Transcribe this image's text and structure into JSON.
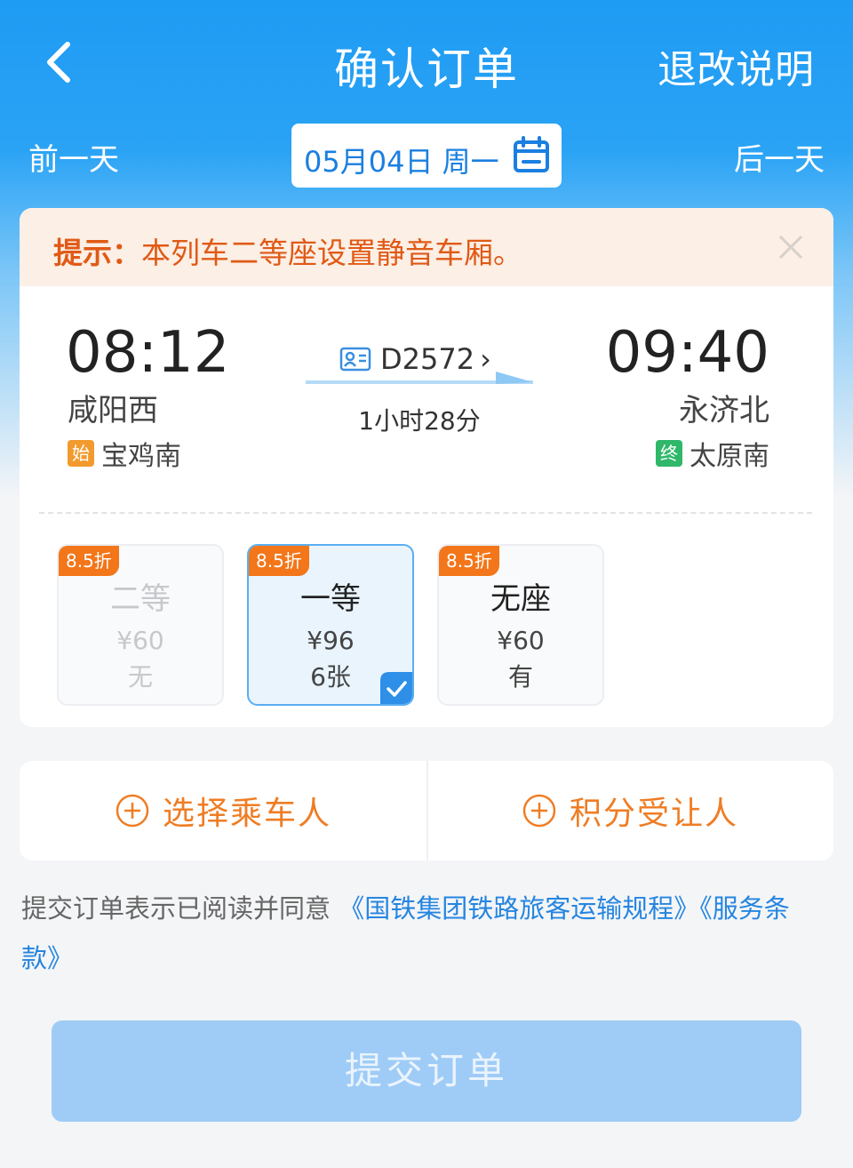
{
  "header": {
    "title": "确认订单",
    "rule_link": "退改说明"
  },
  "date_bar": {
    "prev_label": "前一天",
    "next_label": "后一天",
    "date": "05月04日 周一"
  },
  "tip": {
    "label": "提示：",
    "text": "本列车二等座设置静音车厢。"
  },
  "trip": {
    "departure_time": "08:12",
    "departure_station": "咸阳西",
    "origin_badge": "始",
    "origin_station": "宝鸡南",
    "train_number": "D2572",
    "train_chevron": "›",
    "duration": "1小时28分",
    "arrival_time": "09:40",
    "arrival_station": "永济北",
    "terminal_badge": "终",
    "terminal_station": "太原南"
  },
  "seats": [
    {
      "discount": "8.5折",
      "class": "二等",
      "price": "¥60",
      "availability": "无",
      "state": "disabled"
    },
    {
      "discount": "8.5折",
      "class": "一等",
      "price": "¥96",
      "availability": "6张",
      "state": "selected"
    },
    {
      "discount": "8.5折",
      "class": "无座",
      "price": "¥60",
      "availability": "有",
      "state": "normal"
    }
  ],
  "actions": {
    "select_passenger": "选择乘车人",
    "points_recipient": "积分受让人"
  },
  "agreement": {
    "prefix": "提交订单表示已阅读并同意",
    "link_rules": "《国铁集团铁路旅客运输规程》",
    "link_terms": "《服务条款》"
  },
  "submit": {
    "label": "提交订单"
  },
  "colors": {
    "brand_blue": "#1e9bf3",
    "accent_orange": "#ef7d24",
    "tip_orange": "#e05a16",
    "discount_orange": "#f3761a",
    "submit_disabled": "#9fccf6"
  }
}
